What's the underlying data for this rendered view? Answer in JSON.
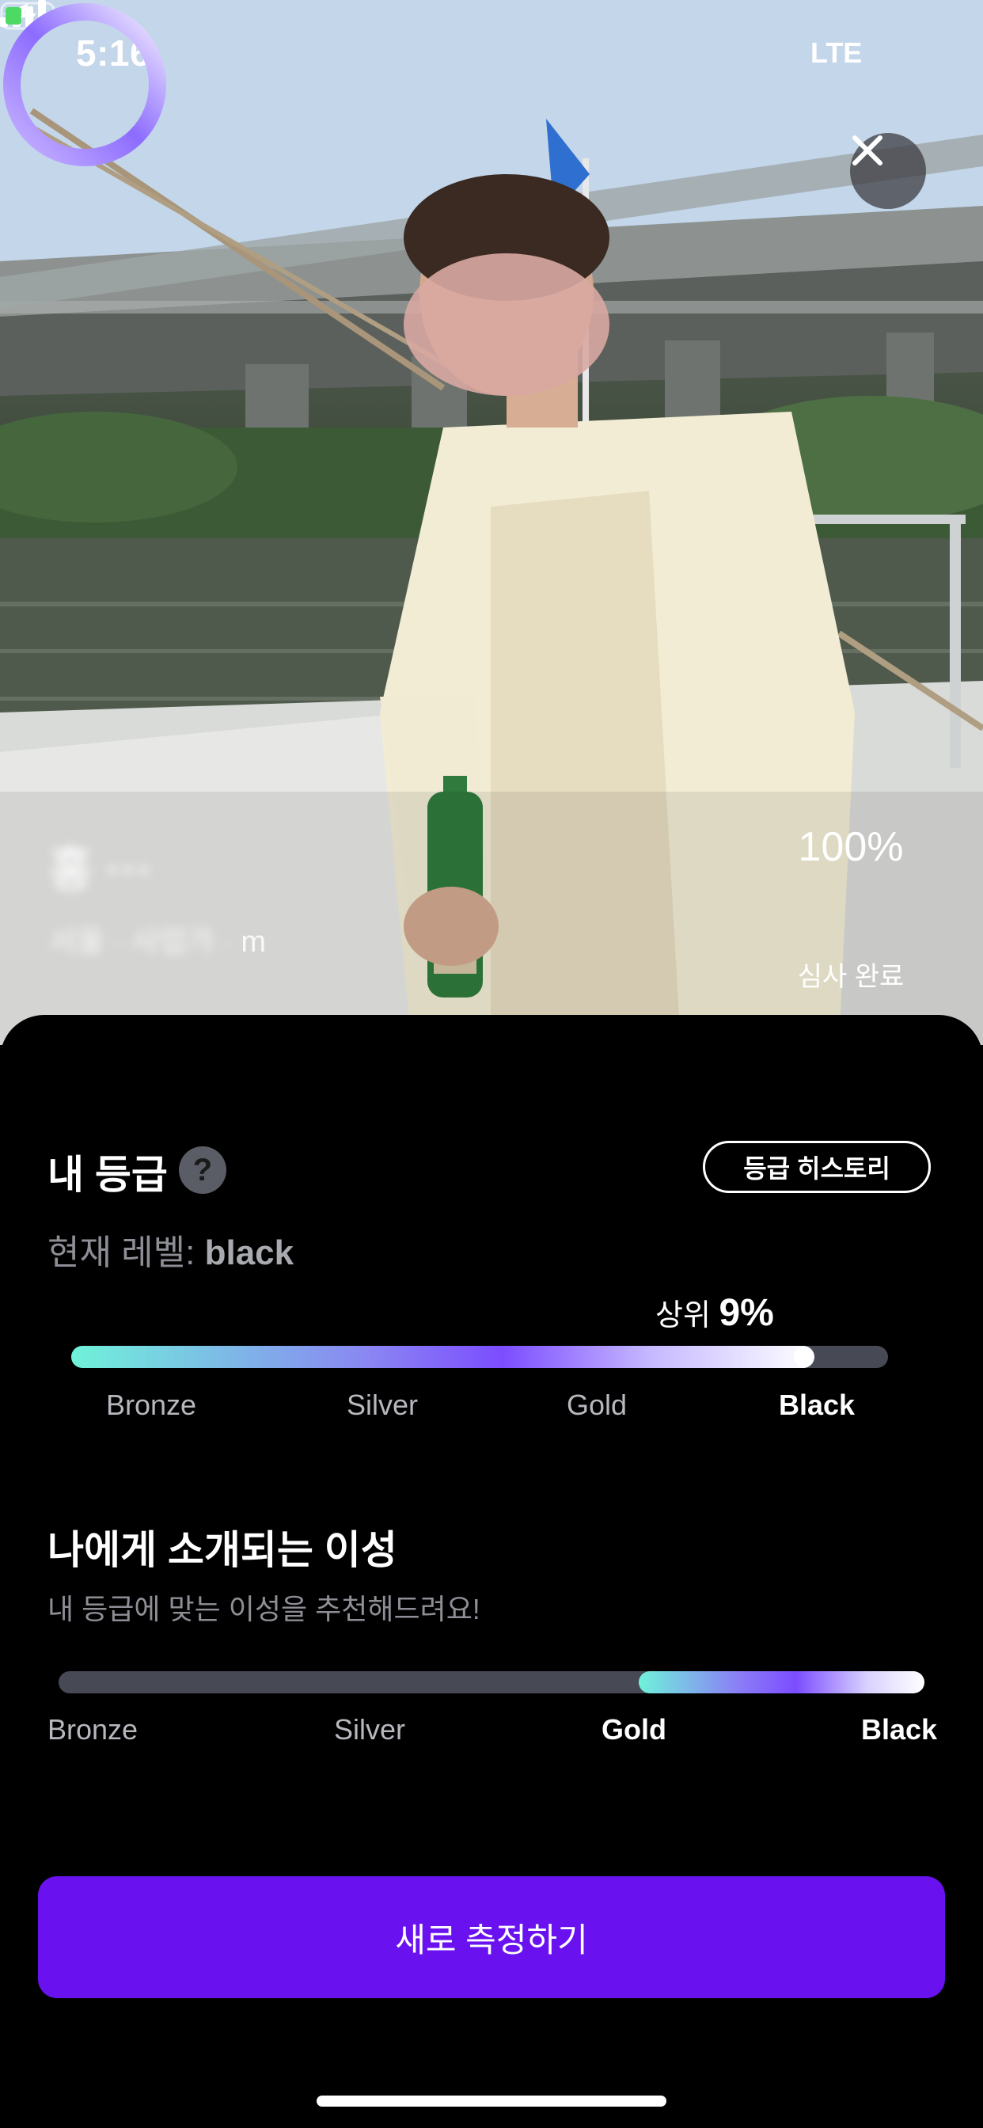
{
  "status_bar": {
    "time": "5:16",
    "network": "LTE",
    "icons": [
      "location-arrow-icon",
      "cellular-signal-icon",
      "battery-charging-icon"
    ]
  },
  "photo": {
    "close_icon": "close-icon",
    "name_obscured": "홍 ··· ",
    "sub_prefix": "서울 · 사업가 · ",
    "sub_suffix": "m",
    "review": {
      "percent_label": "100%",
      "progress": 1.0,
      "label": "심사 완료"
    }
  },
  "my_grade": {
    "title": "내 등급",
    "help_icon": "?",
    "history_button": "등급 히스토리",
    "level_prefix": "현재 레벨: ",
    "level_value": "black",
    "top_prefix": "상위 ",
    "top_value": "9%",
    "progress": 0.91,
    "tiers": [
      "Bronze",
      "Silver",
      "Gold",
      "Black"
    ],
    "active_tier": "Black"
  },
  "matching": {
    "title": "나에게 소개되는 이성",
    "subtitle": "내 등급에 맞는 이성을 추천해드려요!",
    "range_start": 0.67,
    "range_end": 1.0,
    "tiers": [
      "Bronze",
      "Silver",
      "Gold",
      "Black"
    ],
    "active_tiers": [
      "Gold",
      "Black"
    ]
  },
  "cta": {
    "label": "새로 측정하기"
  },
  "colors": {
    "accent": "#6A11F0",
    "sheet_bg": "#000000",
    "track": "#474A55"
  }
}
